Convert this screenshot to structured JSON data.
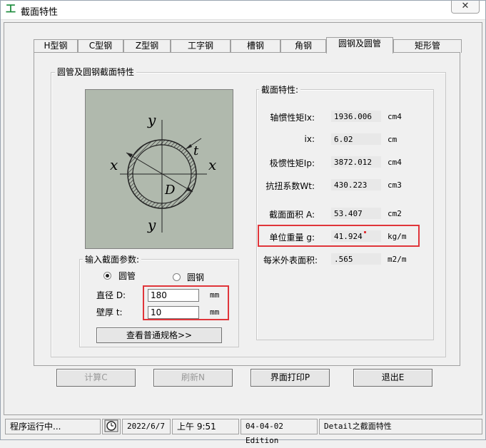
{
  "window": {
    "title": "截面特性",
    "close_glyph": "✕"
  },
  "tabs": [
    "H型钢",
    "C型钢",
    "Z型钢",
    "工字钢",
    "槽钢",
    "角钢",
    "圆钢及圆管",
    "矩形管"
  ],
  "active_tab": "圆钢及圆管",
  "panel": {
    "group_title": "圆管及圆钢截面特性",
    "figure": {
      "y_top": "y",
      "y_bottom": "y",
      "x_left": "x",
      "x_right": "x",
      "t": "t",
      "d": "D"
    },
    "props_title": "截面特性:",
    "props": [
      {
        "label": "轴惯性矩Ix:",
        "value": "1936.006",
        "unit": "cm4"
      },
      {
        "label": "ix:",
        "value": "6.02",
        "unit": "cm"
      },
      {
        "label": "极惯性矩Ip:",
        "value": "3872.012",
        "unit": "cm4"
      },
      {
        "label": "抗扭系数Wt:",
        "value": "430.223",
        "unit": "cm3"
      },
      {
        "label": "截面面积 A:",
        "value": "53.407",
        "unit": "cm2"
      },
      {
        "label": "单位重量 g:",
        "value": "41.924",
        "unit": "kg/m"
      },
      {
        "label": "每米外表面积:",
        "value": ".565",
        "unit": "m2/m"
      }
    ],
    "input_title": "输入截面参数:",
    "radio_pipe": "圆管",
    "radio_bar": "圆钢",
    "diameter_label": "直径 D:",
    "diameter_value": "180",
    "diameter_unit": "mm",
    "thickness_label": "壁厚 t:",
    "thickness_value": "10",
    "thickness_unit": "mm",
    "spec_button": "查看普通规格>>"
  },
  "buttons": {
    "calc": "计算C",
    "refresh": "刷新N",
    "print": "界面打印P",
    "exit": "退出E"
  },
  "statusbar": {
    "status": "程序运行中...",
    "date": "2022/6/7",
    "time": "上午 9:51",
    "edition": "04-04-02 Edition",
    "info": "Detail之截面特性"
  },
  "colors": {
    "highlight": "#e0353a",
    "figure_bg": "#b0b9ad"
  }
}
